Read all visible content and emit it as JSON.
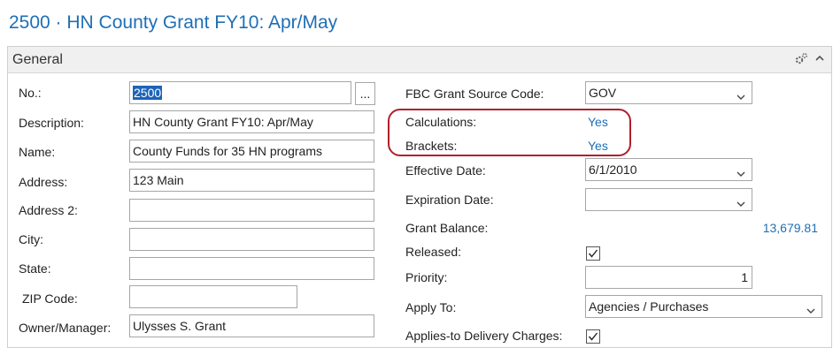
{
  "page": {
    "title": "2500 · HN County Grant FY10: Apr/May"
  },
  "panel": {
    "title": "General"
  },
  "left_fields": {
    "no": {
      "label": "No.:",
      "value": "2500",
      "assist": "..."
    },
    "description": {
      "label": "Description:",
      "value": "HN County Grant FY10: Apr/May"
    },
    "name": {
      "label": "Name:",
      "value": "County Funds for 35 HN programs"
    },
    "address": {
      "label": "Address:",
      "value": "123 Main"
    },
    "address2": {
      "label": "Address 2:",
      "value": ""
    },
    "city": {
      "label": "City:",
      "value": ""
    },
    "state": {
      "label": "State:",
      "value": ""
    },
    "zip": {
      "label": "ZIP Code:",
      "value": ""
    },
    "owner": {
      "label": "Owner/Manager:",
      "value": "Ulysses S. Grant"
    }
  },
  "right_fields": {
    "source_code": {
      "label": "FBC Grant Source Code:",
      "value": "GOV"
    },
    "calculations": {
      "label": "Calculations:",
      "value": "Yes"
    },
    "brackets": {
      "label": "Brackets:",
      "value": "Yes"
    },
    "effective_date": {
      "label": "Effective Date:",
      "value": "6/1/2010"
    },
    "expiration_date": {
      "label": "Expiration Date:",
      "value": ""
    },
    "grant_balance": {
      "label": "Grant Balance:",
      "value": "13,679.81"
    },
    "released": {
      "label": "Released:",
      "checked": true
    },
    "priority": {
      "label": "Priority:",
      "value": "1"
    },
    "apply_to": {
      "label": "Apply To:",
      "value": "Agencies / Purchases"
    },
    "delivery_charges": {
      "label": "Applies-to Delivery Charges:",
      "checked": true
    }
  },
  "icons": {
    "gear": "gear-icon",
    "collapse": "chevron-up-icon",
    "dropdown": "chevron-down-icon",
    "check": "checkmark-icon"
  },
  "colors": {
    "accent": "#1e6fb5",
    "highlight_border": "#b0202a",
    "selection": "#1e63b8"
  }
}
